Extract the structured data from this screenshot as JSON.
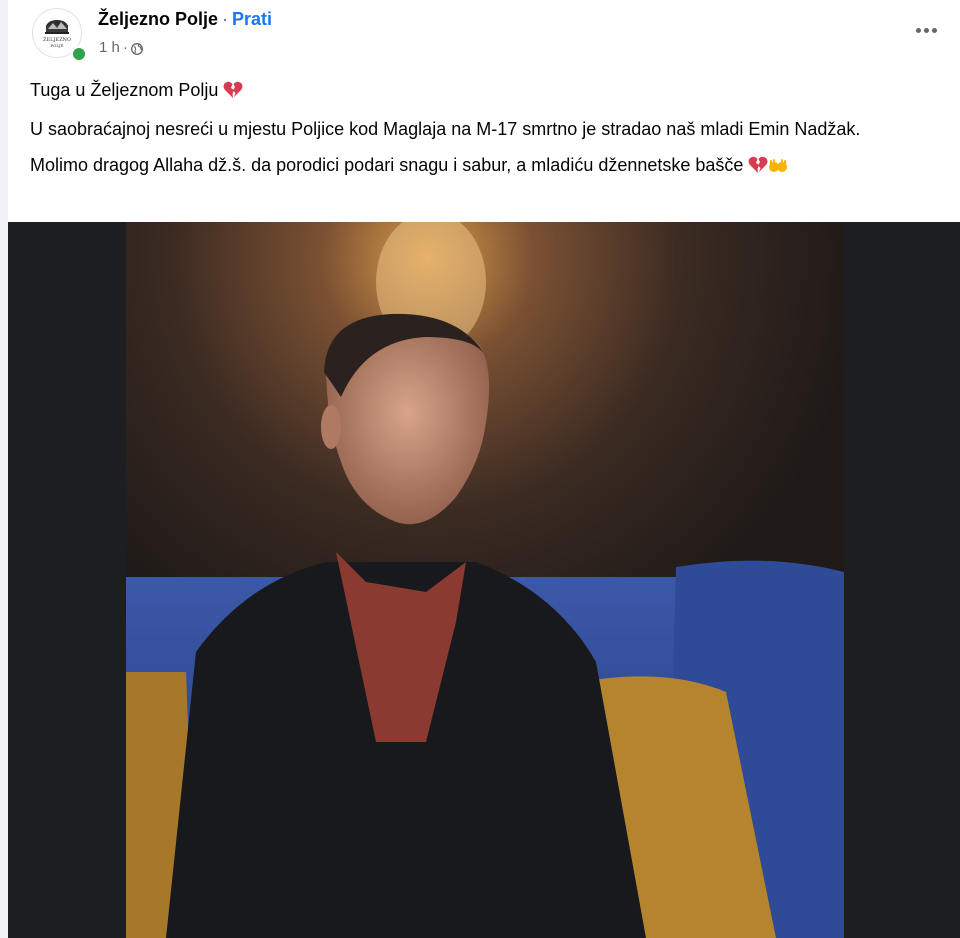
{
  "page": {
    "name": "Željezno Polje",
    "separator": "·",
    "follow_label": "Prati",
    "avatar_text_top": "ŽELJEZNO",
    "avatar_text_bottom": "POLJE"
  },
  "meta": {
    "time": "1 h",
    "separator": "·",
    "privacy_icon": "globe-icon"
  },
  "post": {
    "line1": "Tuga u Željeznom Polju",
    "line2": "U saobraćajnoj nesreći u mjestu Poljice kod Maglaja na M-17 smrtno je stradao naš mladi Emin Nadžak.",
    "line3": "Molimo dragog Allaha dž.š. da porodici podari snagu i sabur, a mladiću džennetske bašče"
  },
  "icons": {
    "more": "more-options-icon",
    "broken_heart": "broken-heart-emoji",
    "open_hands": "open-hands-emoji"
  },
  "colors": {
    "follow": "#1877f2",
    "online": "#31a24c",
    "text": "#050505",
    "meta": "#65676b"
  }
}
